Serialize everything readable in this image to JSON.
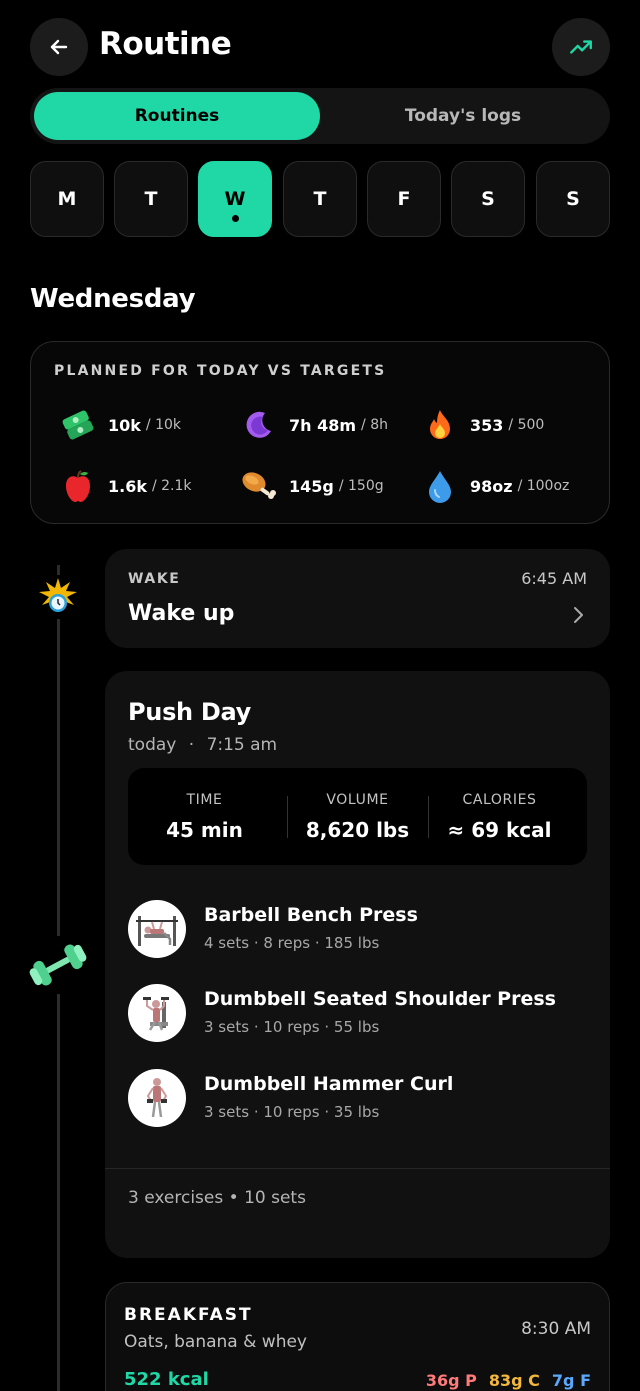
{
  "header": {
    "title": "Routine"
  },
  "tabs": {
    "active": "Routines",
    "inactive": "Today's logs"
  },
  "days": [
    "M",
    "T",
    "W",
    "T",
    "F",
    "S",
    "S"
  ],
  "selected_day_index": 2,
  "weekday_title": "Wednesday",
  "targets": {
    "title": "PLANNED FOR TODAY VS TARGETS",
    "items": [
      {
        "icon": "cash-icon",
        "value": "10k",
        "target": "/ 10k"
      },
      {
        "icon": "moon-icon",
        "value": "7h 48m",
        "target": "/ 8h"
      },
      {
        "icon": "fire-icon",
        "value": "353",
        "target": "/ 500"
      },
      {
        "icon": "apple-icon",
        "value": "1.6k",
        "target": "/ 2.1k"
      },
      {
        "icon": "drumstick-icon",
        "value": "145g",
        "target": "/ 150g"
      },
      {
        "icon": "droplet-icon",
        "value": "98oz",
        "target": "/ 100oz"
      }
    ]
  },
  "wake": {
    "label": "WAKE",
    "time": "6:45 AM",
    "title": "Wake up"
  },
  "workout": {
    "title": "Push Day",
    "day": "today",
    "sep": "·",
    "time": "7:15 am",
    "stats": [
      {
        "label": "TIME",
        "value": "45 min"
      },
      {
        "label": "VOLUME",
        "value": "8,620 lbs"
      },
      {
        "label": "CALORIES",
        "value": "≈ 69 kcal"
      }
    ],
    "exercises": [
      {
        "name": "Barbell Bench Press",
        "meta": "4 sets · 8 reps · 185 lbs"
      },
      {
        "name": "Dumbbell Seated Shoulder Press",
        "meta": "3 sets · 10 reps · 55 lbs"
      },
      {
        "name": "Dumbbell Hammer Curl",
        "meta": "3 sets · 10 reps · 35 lbs"
      }
    ],
    "footer": "3 exercises • 10 sets"
  },
  "breakfast": {
    "label": "BREAKFAST",
    "desc": "Oats, banana & whey",
    "time": "8:30 AM",
    "kcal": "522 kcal",
    "protein": "36g P",
    "carbs": "83g C",
    "fat": "7g F"
  },
  "colors": {
    "accent": "#1fd8a6",
    "bg": "#000000",
    "card": "#111111"
  }
}
